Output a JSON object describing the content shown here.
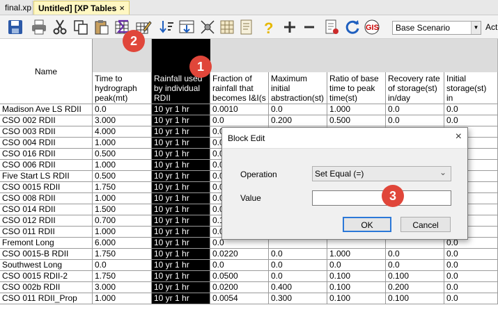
{
  "tabs": [
    {
      "label": "final.xp"
    },
    {
      "label": "Untitled] [XP Tables",
      "close": "×"
    }
  ],
  "toolbar": {
    "icons": [
      "save-icon",
      "print-icon",
      "cut-icon",
      "copy-icon",
      "paste-icon",
      "block-edit-icon",
      "edit-table-icon",
      "sort-icon",
      "filter-icon",
      "select-icon",
      "grid-icon",
      "notes-icon",
      "help-icon",
      "add-row-icon",
      "remove-row-icon",
      "report-icon",
      "refresh-icon",
      "gis-icon"
    ],
    "scenario_value": "Base Scenario",
    "next_label": "Act"
  },
  "grid": {
    "name_header": "Name",
    "columns": [
      {
        "label": "Time to hydrograph peak(mt)"
      },
      {
        "label": "Rainfall used by individual RDII",
        "selected": true
      },
      {
        "label": "Fraction of rainfall that becomes I&I(s"
      },
      {
        "label": "Maximum initial abstraction(st)"
      },
      {
        "label": "Ratio of base time to peak time(st)"
      },
      {
        "label": "Recovery rate of storage(st) in/day"
      },
      {
        "label": "Initial storage(st) in"
      }
    ],
    "rows": [
      {
        "name": "Madison Ave LS RDII",
        "cells": [
          "0.0",
          "10 yr 1 hr",
          "0.0010",
          "0.0",
          "1.000",
          "0.0",
          "0.0"
        ]
      },
      {
        "name": "CSO 002 RDII",
        "cells": [
          "3.000",
          "10 yr 1 hr",
          "0.0",
          "0.200",
          "0.500",
          "0.0",
          "0.0"
        ]
      },
      {
        "name": "CSO 003 RDII",
        "cells": [
          "4.000",
          "10 yr 1 hr",
          "0.0",
          "",
          "",
          "",
          "0.0"
        ]
      },
      {
        "name": "CSO 004 RDII",
        "cells": [
          "1.000",
          "10 yr 1 hr",
          "0.0",
          "",
          "",
          "",
          "0.0"
        ]
      },
      {
        "name": "CSO 016 RDII",
        "cells": [
          "0.500",
          "10 yr 1 hr",
          "0.0",
          "",
          "",
          "",
          "0.0"
        ]
      },
      {
        "name": "CSO 006 RDII",
        "cells": [
          "1.000",
          "10 yr 1 hr",
          "0.0",
          "",
          "",
          "",
          "0.0"
        ]
      },
      {
        "name": "Five Start LS RDII",
        "cells": [
          "0.500",
          "10 yr 1 hr",
          "0.0",
          "",
          "",
          "",
          "0.0"
        ]
      },
      {
        "name": "CSO 0015 RDII",
        "cells": [
          "1.750",
          "10 yr 1 hr",
          "0.0",
          "",
          "",
          "",
          "0.0"
        ]
      },
      {
        "name": "CSO 008 RDII",
        "cells": [
          "1.000",
          "10 yr 1 hr",
          "0.0",
          "",
          "",
          "",
          "0.0"
        ]
      },
      {
        "name": "CSO 014 RDII",
        "cells": [
          "1.500",
          "10 yr 1 hr",
          "0.0",
          "",
          "",
          "",
          "0.0"
        ]
      },
      {
        "name": "CSO 012 RDII",
        "cells": [
          "0.700",
          "10 yr 1 hr",
          "0.1",
          "",
          "",
          "",
          "0.0"
        ]
      },
      {
        "name": "CSO 011 RDII",
        "cells": [
          "1.000",
          "10 yr 1 hr",
          "0.0",
          "",
          "",
          "",
          "0.0"
        ]
      },
      {
        "name": "Fremont Long",
        "cells": [
          "6.000",
          "10 yr 1 hr",
          "0.0",
          "",
          "",
          "",
          "0.0"
        ]
      },
      {
        "name": "CSO 0015-B RDII",
        "cells": [
          "1.750",
          "10 yr 1 hr",
          "0.0220",
          "0.0",
          "1.000",
          "0.0",
          "0.0"
        ]
      },
      {
        "name": "Southwest Long",
        "cells": [
          "0.0",
          "10 yr 1 hr",
          "0.0",
          "0.0",
          "0.0",
          "0.0",
          "0.0"
        ]
      },
      {
        "name": "CSO 0015 RDII-2",
        "cells": [
          "1.750",
          "10 yr 1 hr",
          "0.0500",
          "0.0",
          "0.100",
          "0.100",
          "0.0"
        ]
      },
      {
        "name": "CSO 002b RDII",
        "cells": [
          "3.000",
          "10 yr 1 hr",
          "0.0200",
          "0.400",
          "0.100",
          "0.200",
          "0.0"
        ]
      },
      {
        "name": "CSO 011 RDII_Prop",
        "cells": [
          "1.000",
          "10 yr 1 hr",
          "0.0054",
          "0.300",
          "0.100",
          "0.100",
          "0.0"
        ]
      }
    ]
  },
  "dialog": {
    "title": "Block Edit",
    "close": "×",
    "operation_label": "Operation",
    "operation_value": "Set Equal (=)",
    "value_label": "Value",
    "value": "",
    "ok": "OK",
    "cancel": "Cancel"
  },
  "badges": [
    "1",
    "2",
    "3"
  ],
  "colors": {
    "badge": "#e0463a",
    "selected_column": "#000000",
    "active_tab": "#fff7c2",
    "ok_border": "#2b78d8"
  }
}
